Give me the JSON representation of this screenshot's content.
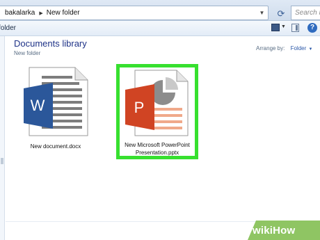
{
  "address_bar": {
    "crumbs": [
      "bakalarka",
      "New folder"
    ],
    "search_placeholder": "Search New folder"
  },
  "toolbar": {
    "label": "folder"
  },
  "library": {
    "title": "Documents library",
    "subtitle": "New folder",
    "arrange_label": "Arrange by:",
    "arrange_value": "Folder"
  },
  "files": [
    {
      "name_lines": [
        "New document.docx"
      ],
      "icon": "word-document-icon",
      "selected": false
    },
    {
      "name_lines": [
        "New Microsoft PowerPoint",
        "Presentation.pptx"
      ],
      "icon": "powerpoint-presentation-icon",
      "selected": true
    }
  ],
  "watermark": {
    "text": "wikiHow"
  },
  "colors": {
    "selection_highlight": "#37e02f",
    "word_blue": "#2b579a",
    "powerpoint_red": "#d04423",
    "library_title": "#1e3287"
  }
}
